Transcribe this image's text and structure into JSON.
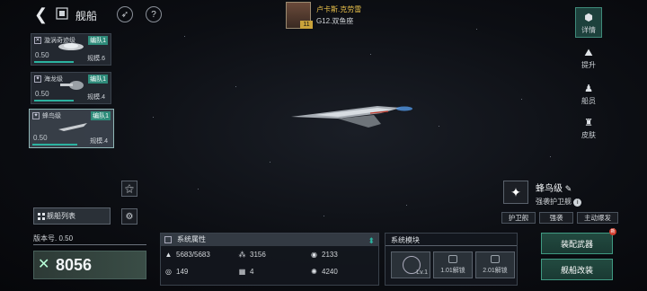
{
  "header": {
    "title": "舰船",
    "commander_name": "卢卡斯.克劳雷",
    "commander_location": "G12.双鱼座",
    "commander_level": "11"
  },
  "ship_list": [
    {
      "name": "漩涡奇迹级",
      "team": "编队1",
      "durability": "0.50",
      "scale": "规模.6",
      "selected": false
    },
    {
      "name": "海龙级",
      "team": "编队1",
      "durability": "0.50",
      "scale": "规模.4",
      "selected": false
    },
    {
      "name": "蜂鸟级",
      "team": "编队1",
      "durability": "0.50",
      "scale": "规模.4",
      "selected": true
    }
  ],
  "sidebar": {
    "list_button": "舰船列表"
  },
  "version": {
    "label": "版本号. 0.50",
    "power": "8056"
  },
  "attributes": {
    "title": "系统属性",
    "stats": [
      {
        "icon": "armor-icon",
        "value": "5683/5683"
      },
      {
        "icon": "firepower-icon",
        "value": "3156"
      },
      {
        "icon": "shield-icon",
        "value": "2133"
      },
      {
        "icon": "speed-icon",
        "value": "149"
      },
      {
        "icon": "grid-icon",
        "value": "4"
      },
      {
        "icon": "energy-icon",
        "value": "4240"
      }
    ]
  },
  "modules": {
    "title": "系统模块",
    "slot0_level": "Lv.1",
    "slot1_label": "1.01解锁",
    "slot2_label": "2.01解锁"
  },
  "nav": [
    {
      "label": "详情",
      "active": true
    },
    {
      "label": "提升",
      "active": false
    },
    {
      "label": "船员",
      "active": false
    },
    {
      "label": "皮肤",
      "active": false
    }
  ],
  "ship_info": {
    "name": "蜂鸟级",
    "class": "强袭护卫舰",
    "tags": [
      "护卫舰",
      "强袭",
      "主动爆发"
    ]
  },
  "actions": {
    "equip": "装配武器",
    "modify": "舰船改装",
    "equip_badge": "新"
  },
  "colors": {
    "accent": "#2bb3a0",
    "commander_name": "#e8c04a",
    "alert": "#d23a2a"
  }
}
